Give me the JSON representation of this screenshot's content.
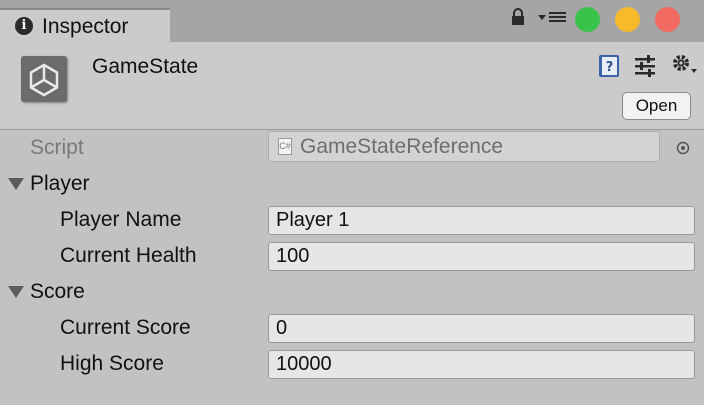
{
  "tab": {
    "label": "Inspector",
    "icon": "info-icon"
  },
  "header": {
    "object_name": "GameState",
    "open_button": "Open"
  },
  "script_row": {
    "label": "Script",
    "value": "GameStateReference",
    "file_badge": "C#"
  },
  "sections": [
    {
      "title": "Player",
      "fields": [
        {
          "label": "Player Name",
          "value": "Player 1"
        },
        {
          "label": "Current Health",
          "value": "100"
        }
      ]
    },
    {
      "title": "Score",
      "fields": [
        {
          "label": "Current Score",
          "value": "0"
        },
        {
          "label": "High Score",
          "value": "10000"
        }
      ]
    }
  ],
  "colors": {
    "close": "#f06a60",
    "minimize": "#f8b92b",
    "zoom": "#3ac34a",
    "panel": "#c2c2c2"
  }
}
